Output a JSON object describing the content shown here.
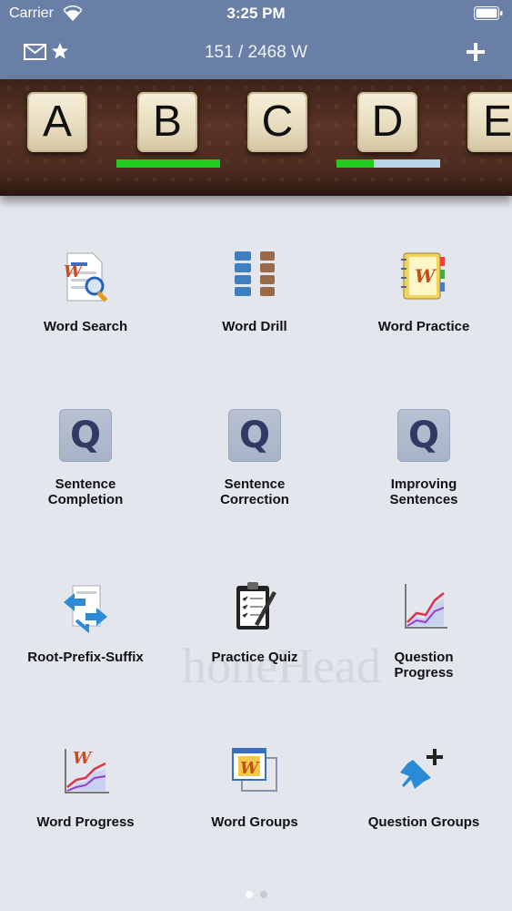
{
  "status": {
    "carrier": "Carrier",
    "time": "3:25 PM"
  },
  "nav": {
    "count": "151 / 2468 W"
  },
  "letters": [
    "A",
    "B",
    "C",
    "D",
    "E"
  ],
  "progress": [
    {
      "letter": "B",
      "fraction": 1.0,
      "color": "#1fcb1f"
    },
    {
      "letter": "D",
      "fraction": 0.36,
      "color": "#1fcb1f",
      "rest_color": "#b4d6e6"
    }
  ],
  "menu": [
    {
      "label": "Word Search",
      "icon": "word-search-icon"
    },
    {
      "label": "Word Drill",
      "icon": "word-drill-icon"
    },
    {
      "label": "Word Practice",
      "icon": "word-practice-icon"
    },
    {
      "label": "Sentence\nCompletion",
      "icon": "q-icon",
      "glyph": "Q"
    },
    {
      "label": "Sentence\nCorrection",
      "icon": "q-icon",
      "glyph": "Q"
    },
    {
      "label": "Improving\nSentences",
      "icon": "q-icon",
      "glyph": "Q"
    },
    {
      "label": "Root-Prefix-Suffix",
      "icon": "root-prefix-suffix-icon"
    },
    {
      "label": "Practice Quiz",
      "icon": "practice-quiz-icon"
    },
    {
      "label": "Question\nProgress",
      "icon": "question-progress-icon"
    },
    {
      "label": "Word Progress",
      "icon": "word-progress-icon"
    },
    {
      "label": "Word Groups",
      "icon": "word-groups-icon"
    },
    {
      "label": "Question Groups",
      "icon": "question-groups-icon"
    }
  ],
  "watermark": "honeHead",
  "pages": {
    "current": 1,
    "total": 2
  }
}
